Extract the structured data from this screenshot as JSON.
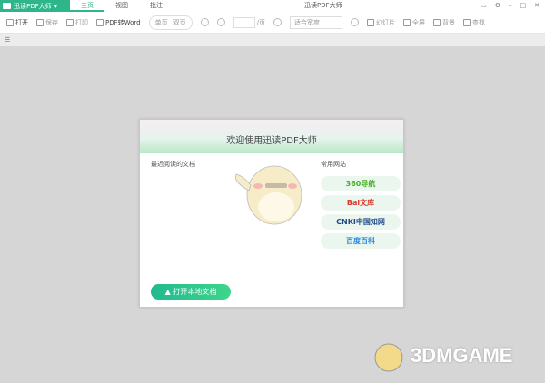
{
  "app": {
    "name": "迅读PDF大师",
    "window_title": "迅读PDF大师"
  },
  "tabs": [
    "主页",
    "视图",
    "批注"
  ],
  "toolbar": {
    "open": "打开",
    "save": "保存",
    "print": "打印",
    "pdf2word": "PDF转Word",
    "single": "单页",
    "double": "双页",
    "page_suffix": "/页",
    "zoom_select": "适合宽度",
    "slideshow": "幻灯片",
    "fullscreen": "全屏",
    "background": "背景",
    "find": "查找"
  },
  "dialog": {
    "title": "欢迎使用迅读PDF大师",
    "recent_label": "最近阅读的文档",
    "sites_label": "常用网站",
    "sites": [
      "360导航",
      "Bai文库",
      "CNKI中国知网",
      "百度百科"
    ],
    "open_local": "打开本地文档"
  },
  "watermark": "3DMGAME",
  "colors": {
    "accent": "#2fb58a"
  }
}
